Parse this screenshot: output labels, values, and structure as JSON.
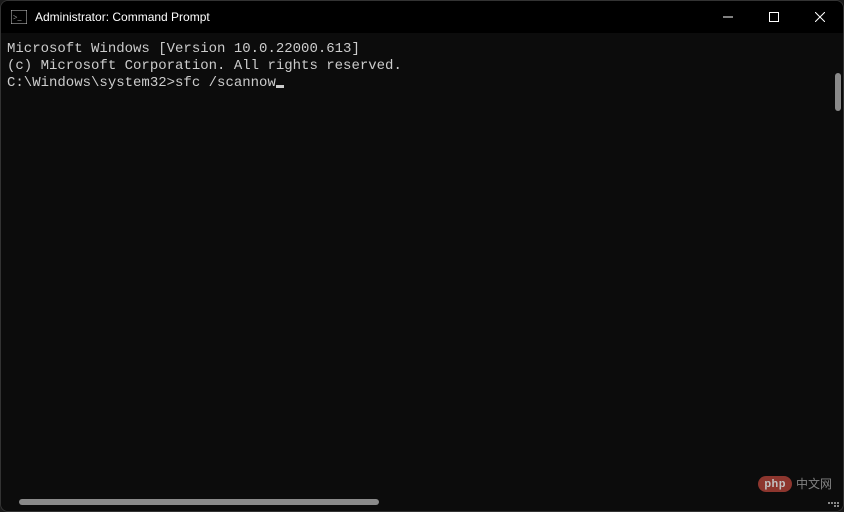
{
  "titlebar": {
    "title": "Administrator: Command Prompt"
  },
  "terminal": {
    "line1": "Microsoft Windows [Version 10.0.22000.613]",
    "line2": "(c) Microsoft Corporation. All rights reserved.",
    "blank": "",
    "prompt": "C:\\Windows\\system32>",
    "input": "sfc /scannow"
  },
  "watermark": {
    "badge": "php",
    "text": "中文网"
  }
}
